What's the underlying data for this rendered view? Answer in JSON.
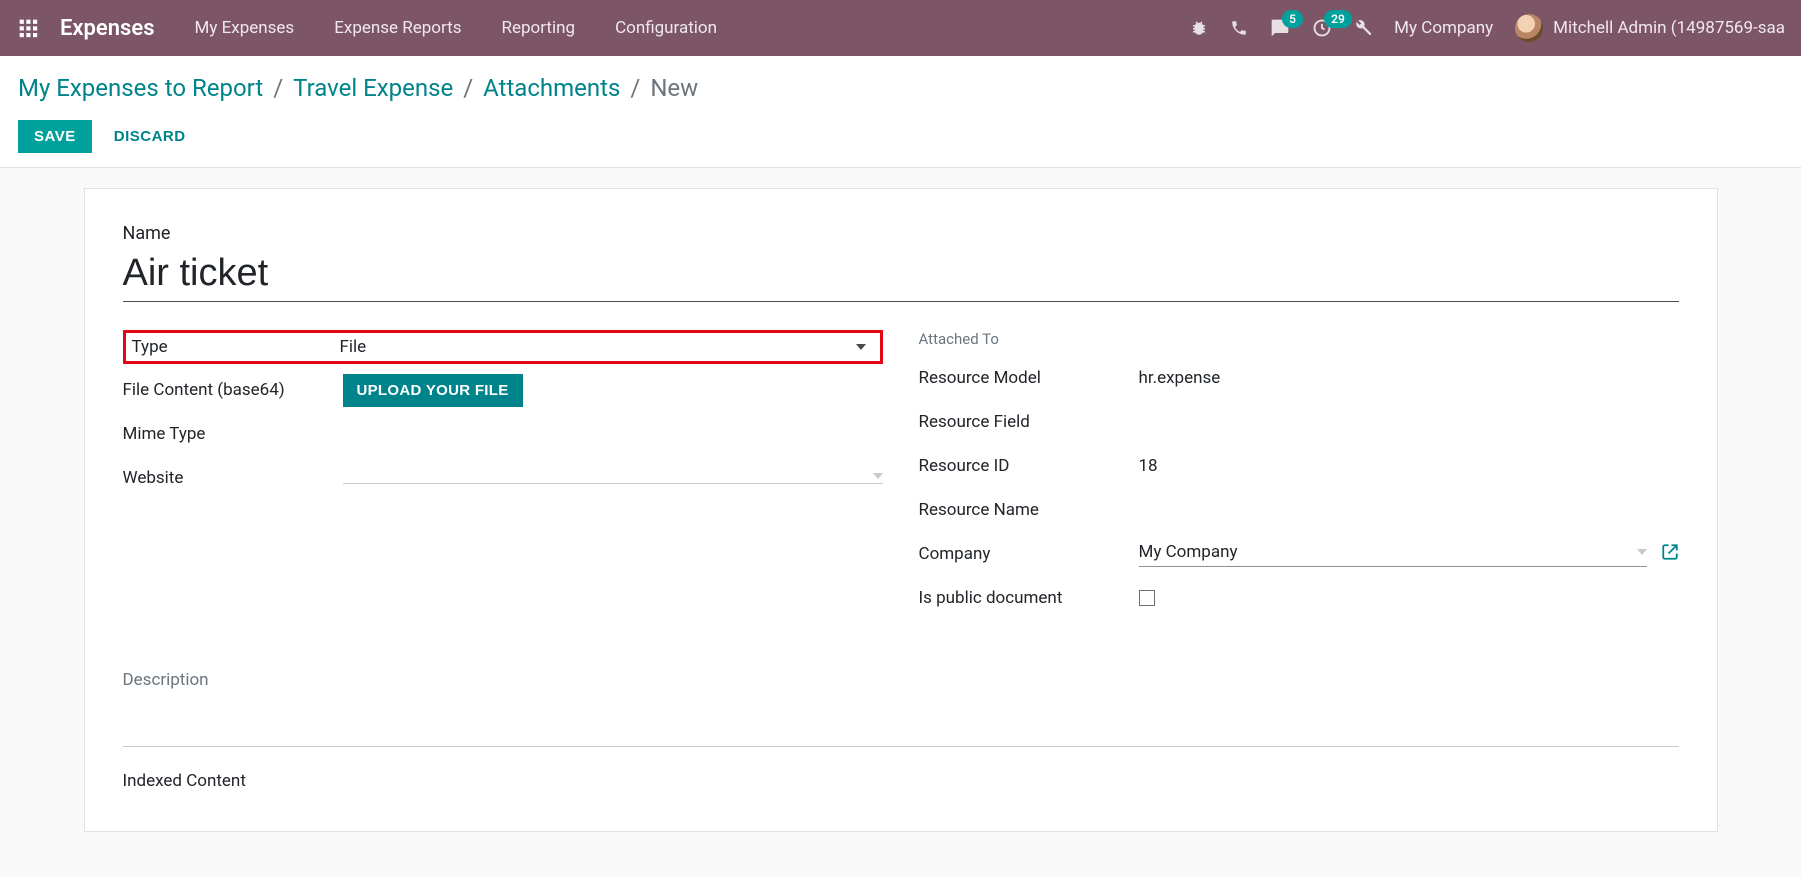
{
  "navbar": {
    "brand": "Expenses",
    "items": [
      "My Expenses",
      "Expense Reports",
      "Reporting",
      "Configuration"
    ],
    "messages_badge": "5",
    "activities_badge": "29",
    "company": "My Company",
    "user": "Mitchell Admin (14987569-saa"
  },
  "breadcrumb": {
    "items": [
      "My Expenses to Report",
      "Travel Expense",
      "Attachments"
    ],
    "current": "New"
  },
  "actions": {
    "save": "SAVE",
    "discard": "DISCARD"
  },
  "form": {
    "name_label": "Name",
    "name_value": "Air ticket",
    "left": {
      "type_label": "Type",
      "type_value": "File",
      "file_content_label": "File Content (base64)",
      "upload_label": "UPLOAD YOUR FILE",
      "mime_label": "Mime Type",
      "website_label": "Website"
    },
    "right": {
      "attached_to": "Attached To",
      "resource_model_label": "Resource Model",
      "resource_model_value": "hr.expense",
      "resource_field_label": "Resource Field",
      "resource_id_label": "Resource ID",
      "resource_id_value": "18",
      "resource_name_label": "Resource Name",
      "company_label": "Company",
      "company_value": "My Company",
      "is_public_label": "Is public document"
    },
    "description_label": "Description",
    "indexed_content_label": "Indexed Content"
  }
}
